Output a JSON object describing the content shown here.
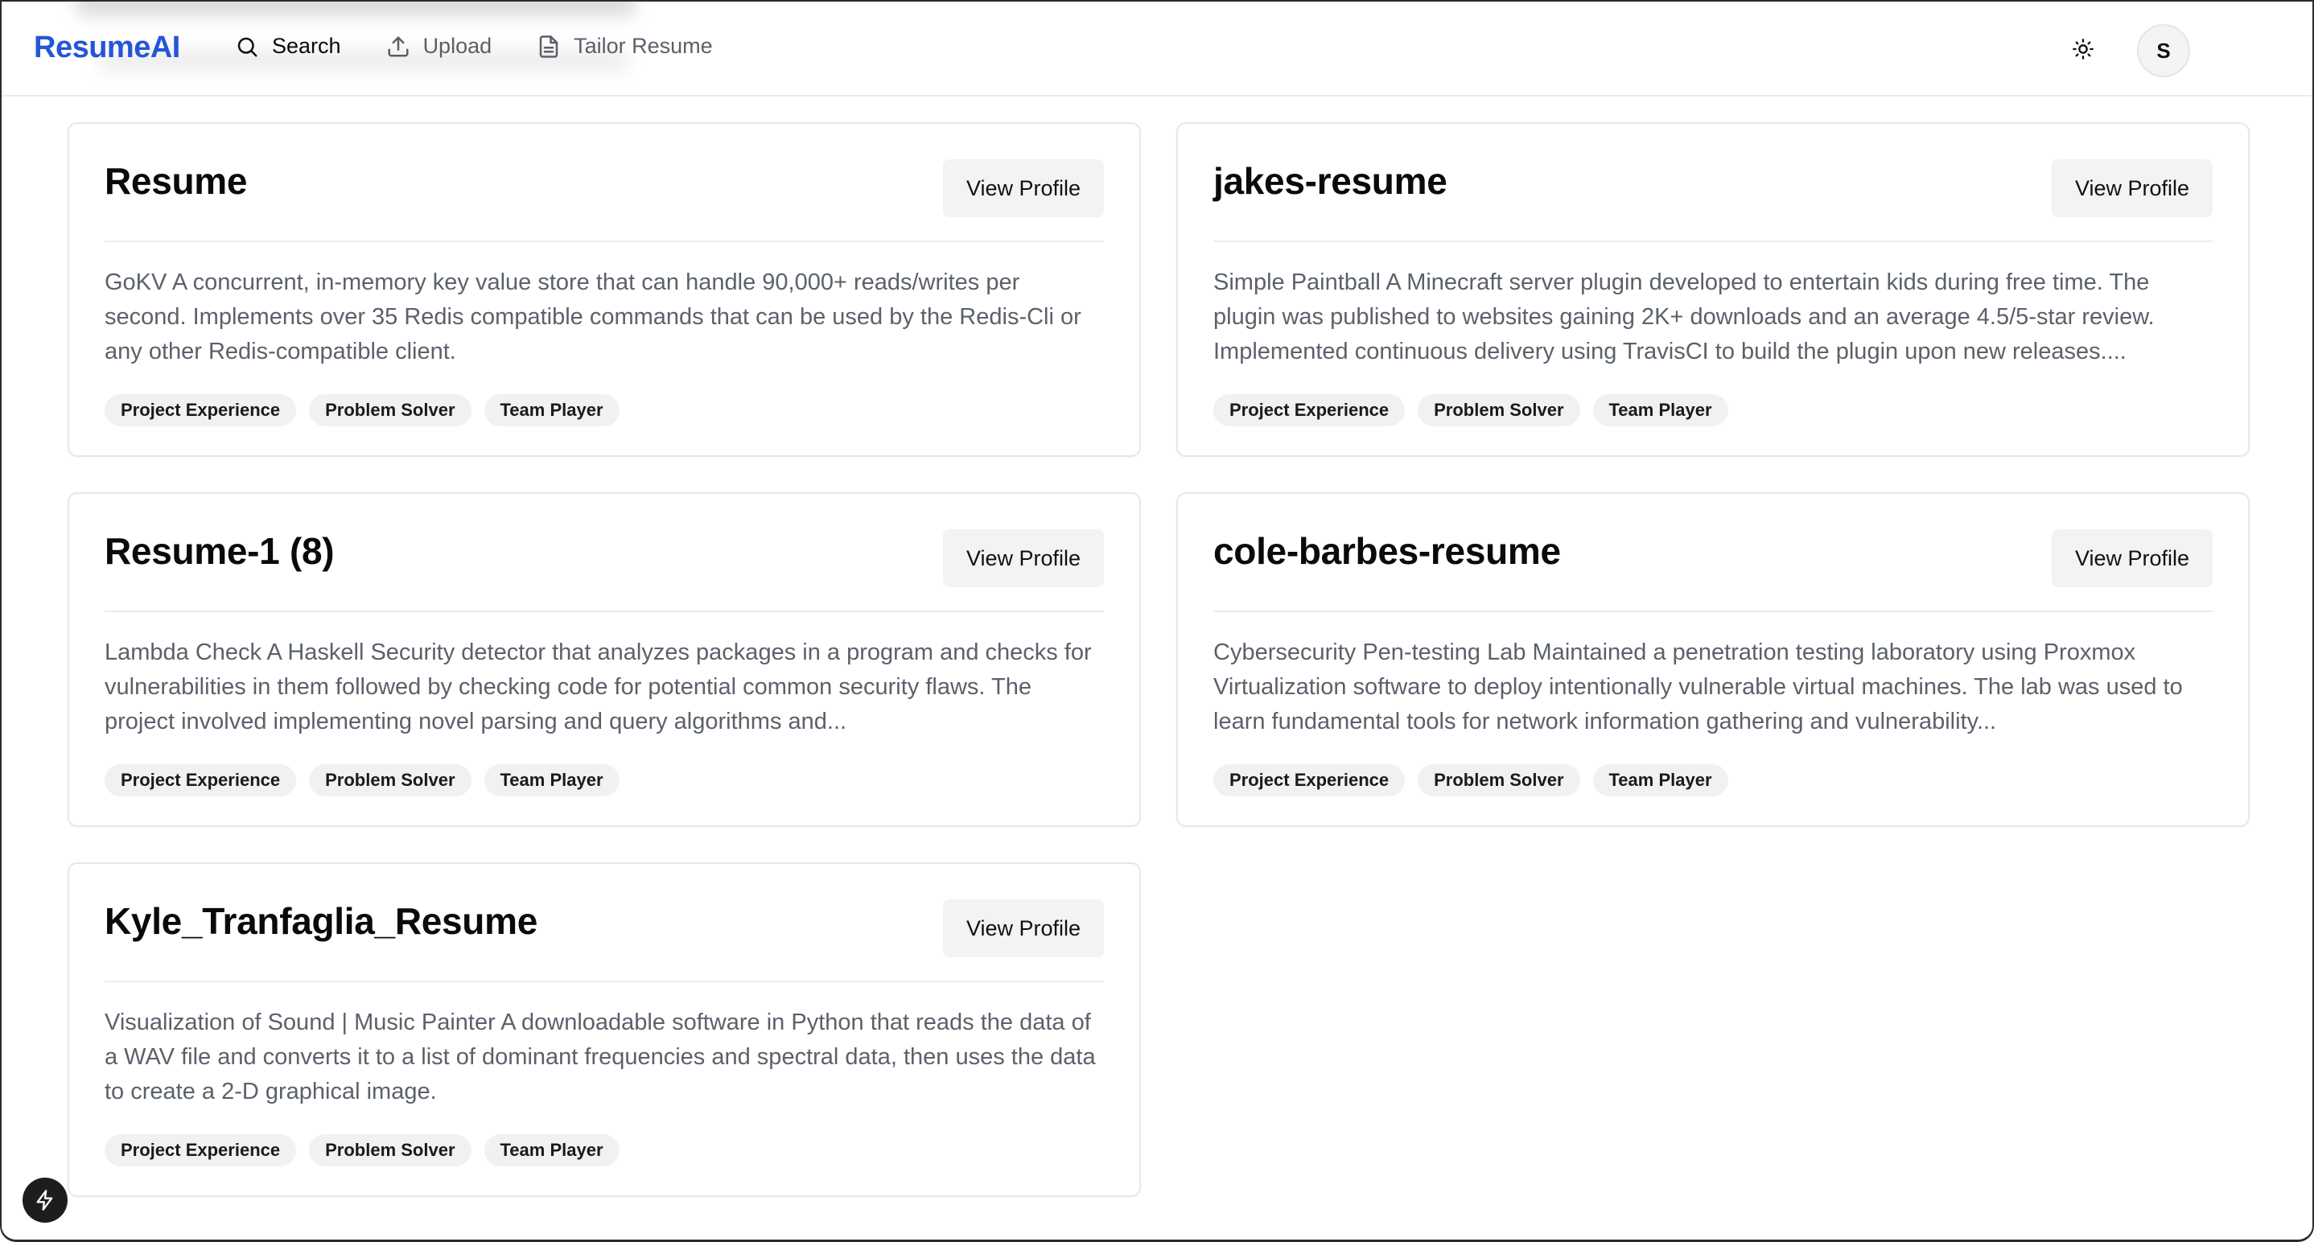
{
  "header": {
    "logo": "ResumeAI",
    "nav": [
      {
        "label": "Search",
        "icon": "search-icon",
        "active": true
      },
      {
        "label": "Upload",
        "icon": "upload-icon",
        "active": false
      },
      {
        "label": "Tailor Resume",
        "icon": "document-icon",
        "active": false
      }
    ],
    "avatar_initial": "S"
  },
  "colors": {
    "brand": "#2456d6",
    "tag_bg": "#f1f1f3",
    "button_bg": "#f3f3f5"
  },
  "cards": [
    {
      "title": "Resume",
      "button": "View Profile",
      "description": "GoKV A concurrent, in-memory key value store that can handle 90,000+ reads/writes per second. Implements over 35 Redis compatible commands that can be used by the Redis-Cli or any other Redis-compatible client.",
      "tags": [
        "Project Experience",
        "Problem Solver",
        "Team Player"
      ]
    },
    {
      "title": "jakes-resume",
      "button": "View Profile",
      "description": "Simple Paintball A Minecraft server plugin developed to entertain kids during free time. The plugin was published to websites gaining 2K+ downloads and an average 4.5/5-star review. Implemented continuous delivery using TravisCI to build the plugin upon new releases....",
      "tags": [
        "Project Experience",
        "Problem Solver",
        "Team Player"
      ]
    },
    {
      "title": "Resume-1 (8)",
      "button": "View Profile",
      "description": "Lambda Check A Haskell Security detector that analyzes packages in a program and checks for vulnerabilities in them followed by checking code for potential common security flaws. The project involved implementing novel parsing and query algorithms and...",
      "tags": [
        "Project Experience",
        "Problem Solver",
        "Team Player"
      ]
    },
    {
      "title": "cole-barbes-resume",
      "button": "View Profile",
      "description": "Cybersecurity Pen-testing Lab Maintained a penetration testing laboratory using Proxmox Virtualization software to deploy intentionally vulnerable virtual machines. The lab was used to learn fundamental tools for network information gathering and vulnerability...",
      "tags": [
        "Project Experience",
        "Problem Solver",
        "Team Player"
      ]
    },
    {
      "title": "Kyle_Tranfaglia_Resume",
      "button": "View Profile",
      "description": "Visualization of Sound | Music Painter A downloadable software in Python that reads the data of a WAV file and converts it to a list of dominant frequencies and spectral data, then uses the data to create a 2-D graphical image.",
      "tags": [
        "Project Experience",
        "Problem Solver",
        "Team Player"
      ]
    }
  ]
}
